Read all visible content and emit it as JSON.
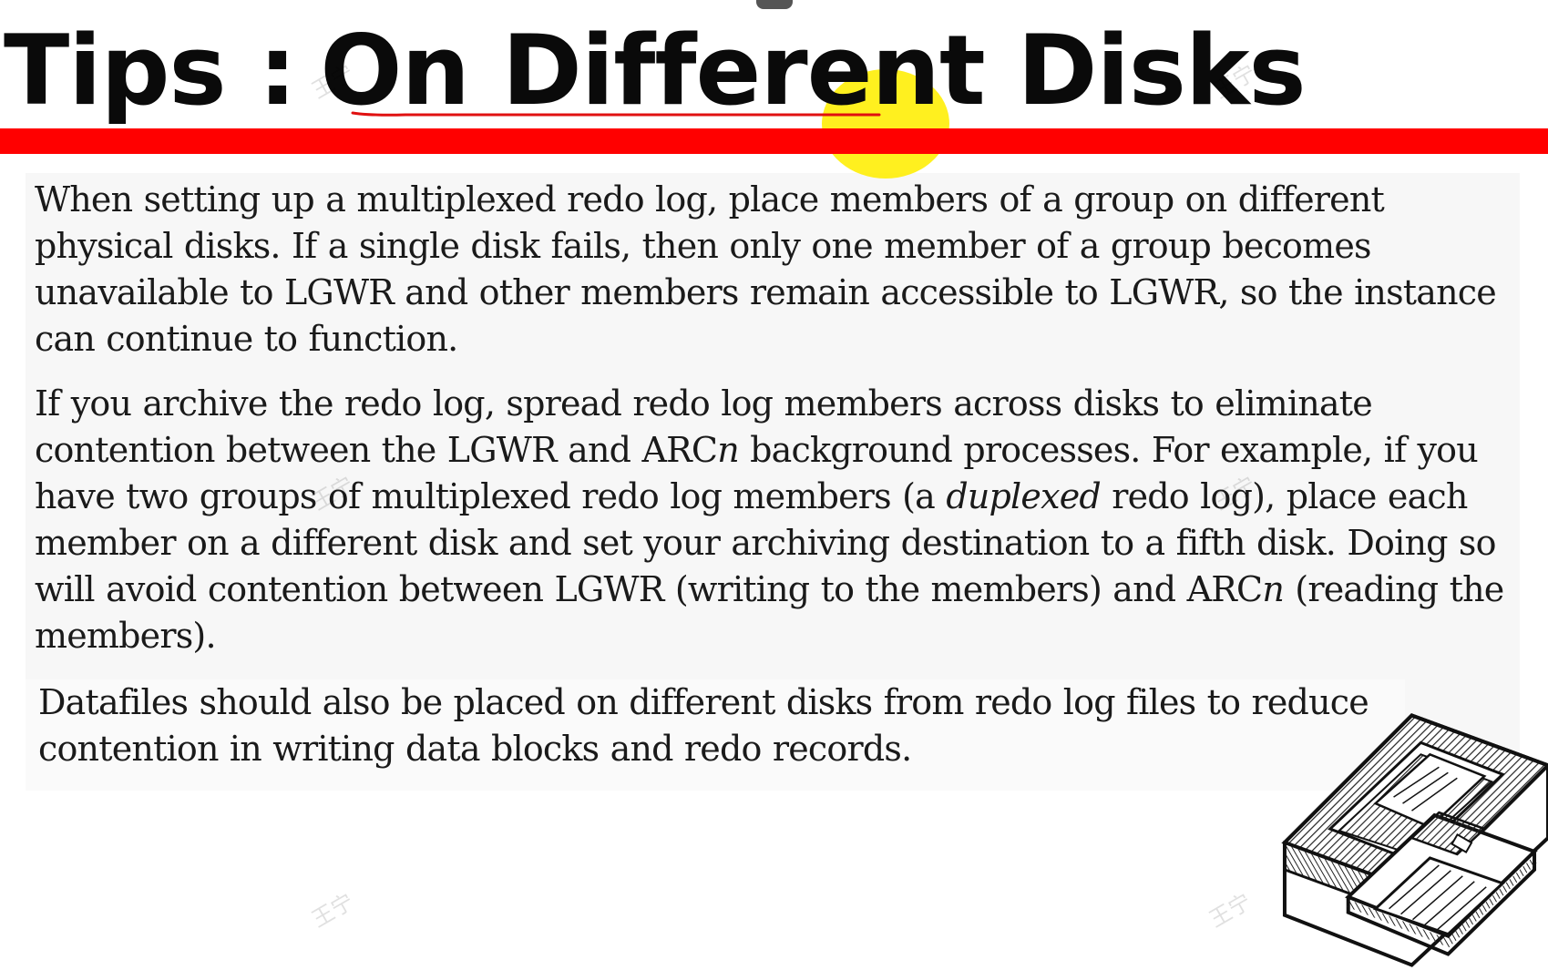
{
  "slide": {
    "title_prefix": "Tips :",
    "title_main": "On Different Disks",
    "paragraphs": {
      "p1": "When setting up a multiplexed redo log, place members of a group on different physical disks. If a single disk fails, then only one member of a group becomes unavailable to LGWR and other members remain accessible to LGWR, so the instance can continue to function.",
      "p2": {
        "s1": "If you archive the redo log, spread redo log members across disks to eliminate contention between the LGWR and ARC",
        "s1_italic": "n",
        "s2": " background processes. For example, if you have two groups of multiplexed redo log members (a ",
        "s2_italic": "duplexed",
        "s3": " redo log), place each member on a different disk and set your archiving destination to a fifth disk. Doing so will avoid contention between LGWR (writing to the members) and ARC",
        "s3_italic": "n",
        "s4": " (reading the members)."
      },
      "p3": "Datafiles should also be placed on different disks from redo log files to reduce contention in writing data blocks and redo records."
    },
    "watermarks": [
      "王宁",
      "王宁",
      "王宁",
      "王宁",
      "王宁",
      "王宁"
    ],
    "colors": {
      "accent_bar": "#ff0000",
      "pointer_highlight": "#ffee00",
      "pen_stroke": "#e01010"
    },
    "icons": {
      "illustration": "floppy-disks-icon"
    }
  }
}
